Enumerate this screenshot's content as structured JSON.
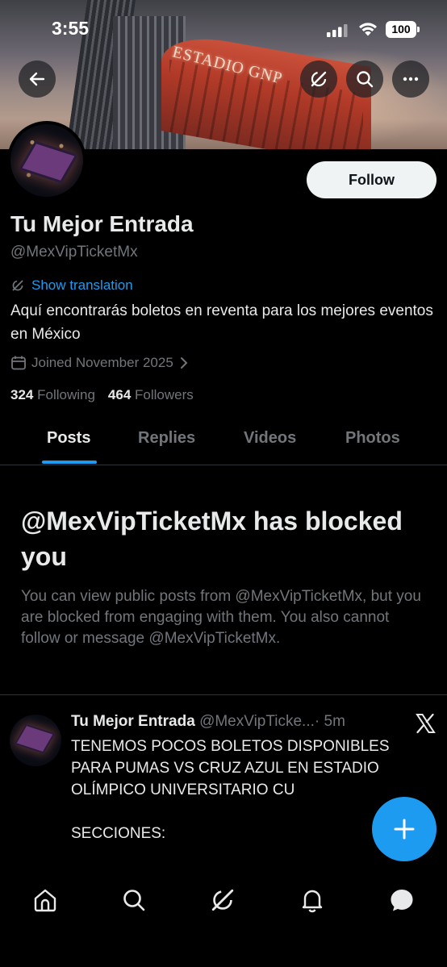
{
  "status_bar": {
    "time": "3:55",
    "battery": "100"
  },
  "banner": {
    "sign_text": "ESTADIO GNP"
  },
  "profile": {
    "follow_label": "Follow",
    "name": "Tu Mejor Entrada",
    "handle": "@MexVipTicketMx",
    "show_translation": "Show translation",
    "bio": "Aquí encontrarás boletos en reventa para los mejores eventos en México",
    "joined": "Joined November 2025",
    "following_count": "324",
    "following_label": "Following",
    "followers_count": "464",
    "followers_label": "Followers"
  },
  "tabs": [
    {
      "label": "Posts",
      "active": true
    },
    {
      "label": "Replies",
      "active": false
    },
    {
      "label": "Videos",
      "active": false
    },
    {
      "label": "Photos",
      "active": false
    }
  ],
  "blocked": {
    "title": "@MexVipTicketMx has blocked you",
    "text": "You can view public posts from @MexVipTicketMx, but you are blocked from engaging with them. You also cannot follow or message @MexVipTicketMx."
  },
  "post": {
    "name": "Tu Mejor Entrada",
    "handle": "@MexVipTicke...",
    "time": "· 5m",
    "body": "TENEMOS POCOS BOLETOS DISPONIBLES PARA PUMAS VS CRUZ AZUL EN ESTADIO OLÍMPICO UNIVERSITARIO CU\n\nSECCIONES:"
  },
  "icons": {
    "back": "arrow-left-icon",
    "grok": "grok-icon",
    "search": "search-icon",
    "more": "more-icon",
    "translate": "translate-icon",
    "calendar": "calendar-icon",
    "chevron": "chevron-right-icon",
    "x_logo": "x-logo-icon",
    "compose": "plus-icon",
    "home": "home-icon",
    "notifications": "bell-icon",
    "messages": "message-icon"
  },
  "colors": {
    "accent": "#1d9bf0",
    "background": "#000000",
    "muted": "#71767b",
    "text": "#e7e9ea"
  }
}
